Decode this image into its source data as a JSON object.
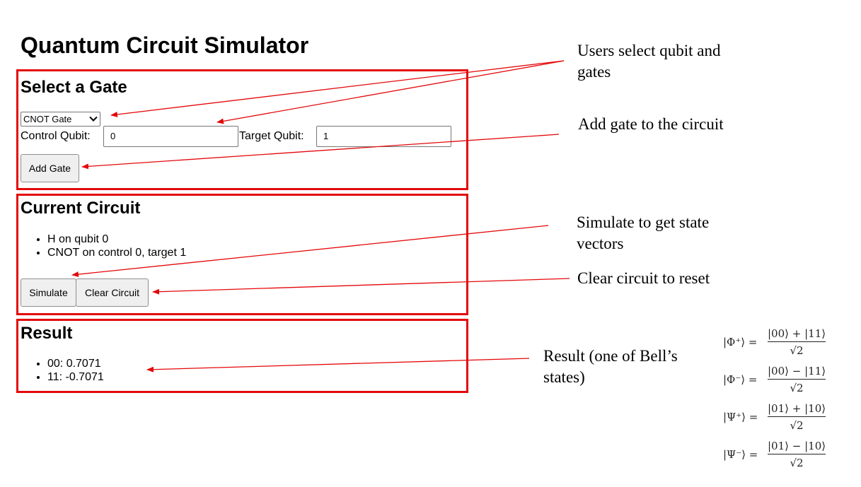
{
  "app": {
    "title": "Quantum Circuit Simulator"
  },
  "gate_section": {
    "title": "Select a Gate",
    "selected_gate": "CNOT Gate",
    "control_label": "Control Qubit:",
    "control_value": "0",
    "target_label": "Target Qubit:",
    "target_value": "1",
    "add_button": "Add Gate"
  },
  "circuit_section": {
    "title": "Current Circuit",
    "items": [
      "H on qubit 0",
      "CNOT on control 0, target 1"
    ],
    "simulate_button": "Simulate",
    "clear_button": "Clear Circuit"
  },
  "result_section": {
    "title": "Result",
    "items": [
      "00: 0.7071",
      "11: -0.7071"
    ]
  },
  "annotations": {
    "select": [
      "Users select qubit and",
      "gates"
    ],
    "add": [
      "Add gate to the circuit"
    ],
    "simulate": [
      "Simulate to get state",
      "vectors"
    ],
    "clear": [
      "Clear circuit to reset"
    ],
    "result": [
      "Result (one of Bell’s",
      "states)"
    ]
  },
  "bell_states": [
    {
      "lhs": "|Φ⁺⟩ =",
      "numerator": "|00⟩ + |11⟩",
      "denominator": "√2"
    },
    {
      "lhs": "|Φ⁻⟩ =",
      "numerator": "|00⟩ − |11⟩",
      "denominator": "√2"
    },
    {
      "lhs": "|Ψ⁺⟩ =",
      "numerator": "|01⟩ + |10⟩",
      "denominator": "√2"
    },
    {
      "lhs": "|Ψ⁻⟩ =",
      "numerator": "|01⟩ − |10⟩",
      "denominator": "√2"
    }
  ],
  "colors": {
    "annotation_red": "#e4080a"
  }
}
